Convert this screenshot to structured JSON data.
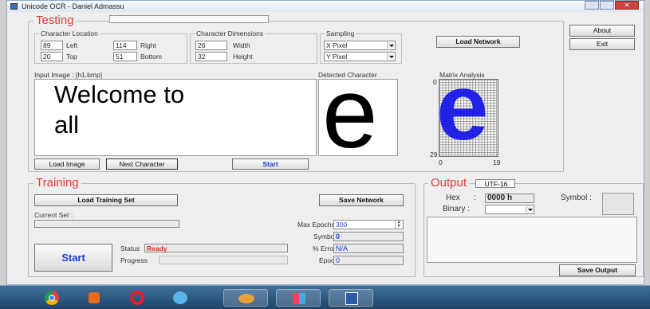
{
  "window": {
    "title": "Unicode OCR - Daniel Admassu"
  },
  "testing": {
    "title": "Testing",
    "char_location": {
      "caption": "Character Location",
      "left_value": "89",
      "left_label": "Left",
      "right_value": "114",
      "right_label": "Right",
      "top_value": "20",
      "top_label": "Top",
      "bottom_value": "51",
      "bottom_label": "Bottom"
    },
    "char_dimensions": {
      "caption": "Character Dimensions",
      "width_value": "26",
      "width_label": "Width",
      "height_value": "32",
      "height_label": "Height"
    },
    "sampling": {
      "caption": "Sampling",
      "x_value": "X  Pixel",
      "y_value": "Y  Pixel"
    },
    "load_network": "Load Network",
    "input_image_label": "Input Image : [h1.bmp]",
    "input_text_line1": "Welcome to",
    "input_text_line2": "all",
    "detected_label": "Detected Character",
    "detected_char": "e",
    "matrix_label": "Matrix Analysis",
    "matrix_top": "0",
    "matrix_bottom": "29",
    "matrix_x0": "0",
    "matrix_x1": "19",
    "matrix_char": "e",
    "load_image": "Load Image",
    "next_character": "Next Character",
    "start": "Start"
  },
  "side": {
    "about": "About",
    "exit": "Exit"
  },
  "training": {
    "title": "Training",
    "load_training_set": "Load Training Set",
    "save_network": "Save Network",
    "current_set_label": "Current Set :",
    "max_epochs_label": "Max Epochs",
    "max_epochs_value": "300",
    "symbols_label": "Symbols",
    "symbols_value": "0",
    "error_label": "% Error",
    "error_value": "N/A",
    "epoch_label": "Epoch",
    "epoch_value": "0",
    "status_label": "Status",
    "status_value": "Ready",
    "progress_label": "Progress",
    "start": "Start"
  },
  "output": {
    "title": "Output",
    "encoding": "UTF-16",
    "hex_label": "Hex",
    "hex_value": "0000 h",
    "binary_label": "Binary :",
    "symbol_label": "Symbol :",
    "save_output": "Save Output"
  },
  "taskbar": {
    "icons": [
      "chrome-icon",
      "media-player-icon",
      "opera-icon",
      "browser-icon",
      "paint-icon",
      "window-icon",
      "word-icon"
    ]
  }
}
